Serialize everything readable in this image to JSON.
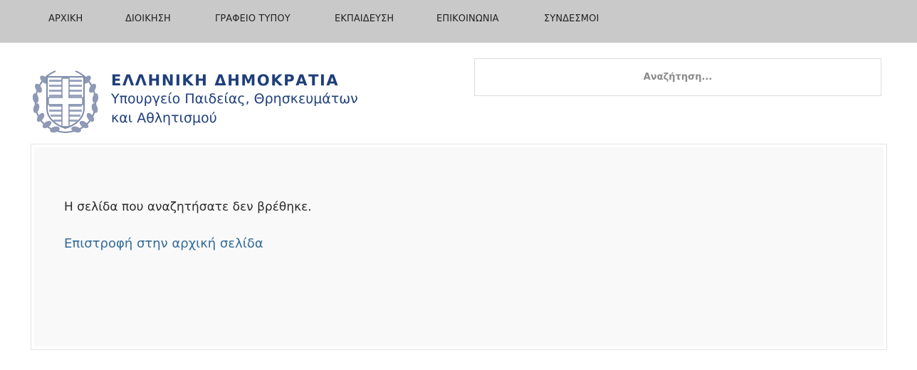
{
  "nav": {
    "items": [
      {
        "label": "ΑΡΧΙΚΗ"
      },
      {
        "label": "ΔΙΟΙΚΗΣΗ"
      },
      {
        "label": "ΓΡΑΦΕΙΟ ΤΥΠΟΥ"
      },
      {
        "label": "ΕΚΠΑΙΔΕΥΣΗ"
      },
      {
        "label": "ΕΠΙΚΟΙΝΩΝΙΑ"
      },
      {
        "label": "ΣΥΝΔΕΣΜΟΙ"
      }
    ]
  },
  "logo": {
    "line1": "ΕΛΛΗΝΙΚΗ ΔΗΜΟΚΡΑΤΙΑ",
    "line2": "Υπουργείο Παιδείας, Θρησκευμάτων",
    "line3": "και Αθλητισμού",
    "emblem_icon": "greek-coat-of-arms-icon",
    "color": "#1f3f7a"
  },
  "search": {
    "placeholder": "Αναζήτηση..."
  },
  "content": {
    "message": "Η σελίδα που αναζητήσατε δεν βρέθηκε.",
    "home_link_label": "Επιστροφή στην αρχική σελίδα",
    "link_color": "#336b99"
  },
  "colors": {
    "nav_bg": "#c9c9c9",
    "content_bg": "#f9f9f9"
  }
}
